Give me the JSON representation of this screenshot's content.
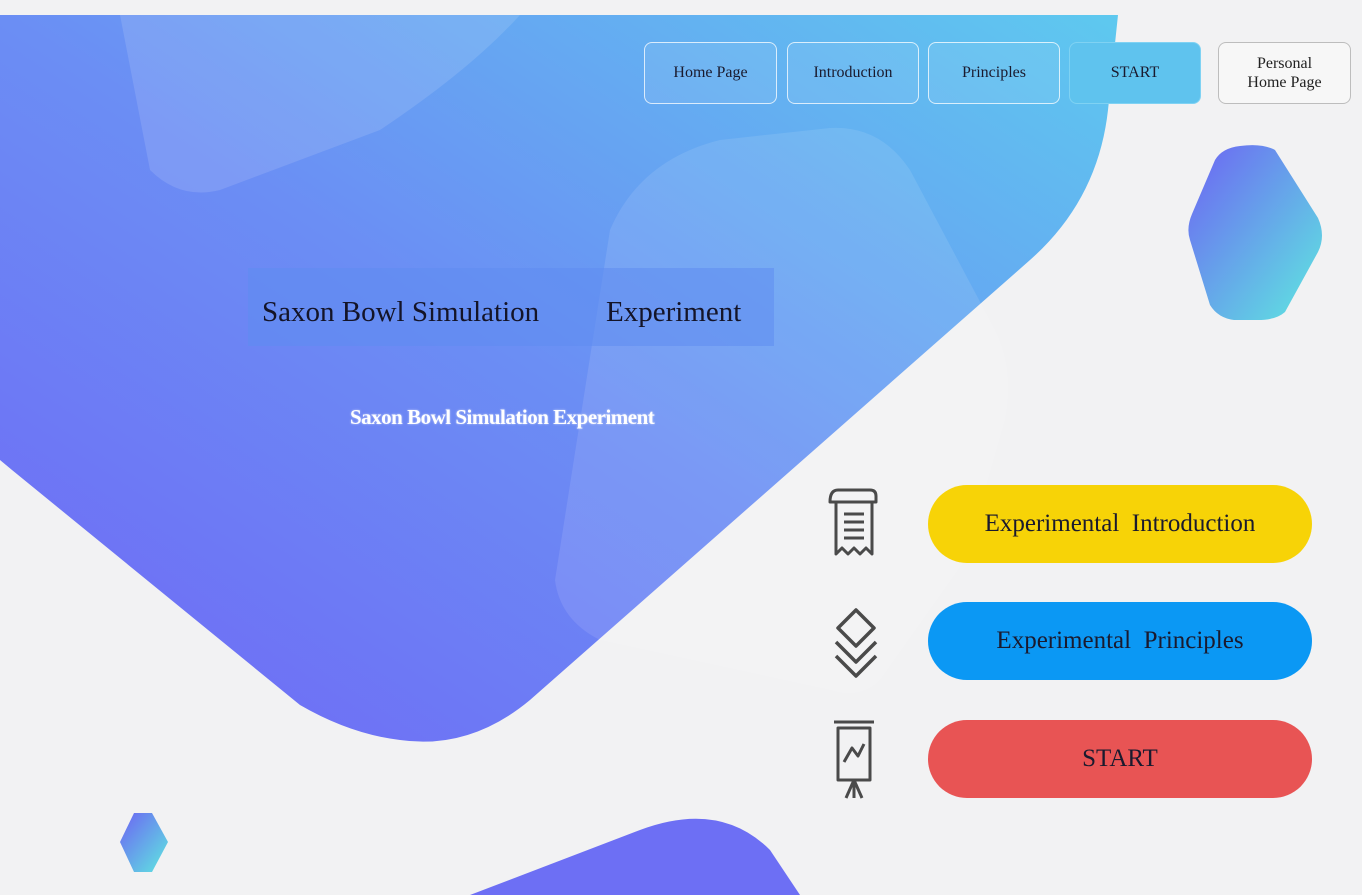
{
  "nav": {
    "home": "Home Page",
    "introduction": "Introduction",
    "principles": "Principles",
    "start": "START",
    "personal_line1": "Personal",
    "personal_line2": "Home Page"
  },
  "hero": {
    "title_part1": "Saxon Bowl Simulation",
    "title_part2": "Experiment",
    "subtitle": "Saxon Bowl Simulation Experiment"
  },
  "menu": {
    "items": [
      {
        "label": "Experimental  Introduction",
        "icon": "scroll-document-icon",
        "color": "#f7d307"
      },
      {
        "label": "Experimental  Principles",
        "icon": "layers-icon",
        "color": "#0b98f4"
      },
      {
        "label": "START",
        "icon": "presentation-board-icon",
        "color": "#e85454"
      }
    ]
  },
  "colors": {
    "gradient_blue": "#6fa8f5",
    "gradient_purple": "#6f6ff5",
    "hex_cyan": "#56e3e0",
    "background": "#f2f2f3"
  }
}
